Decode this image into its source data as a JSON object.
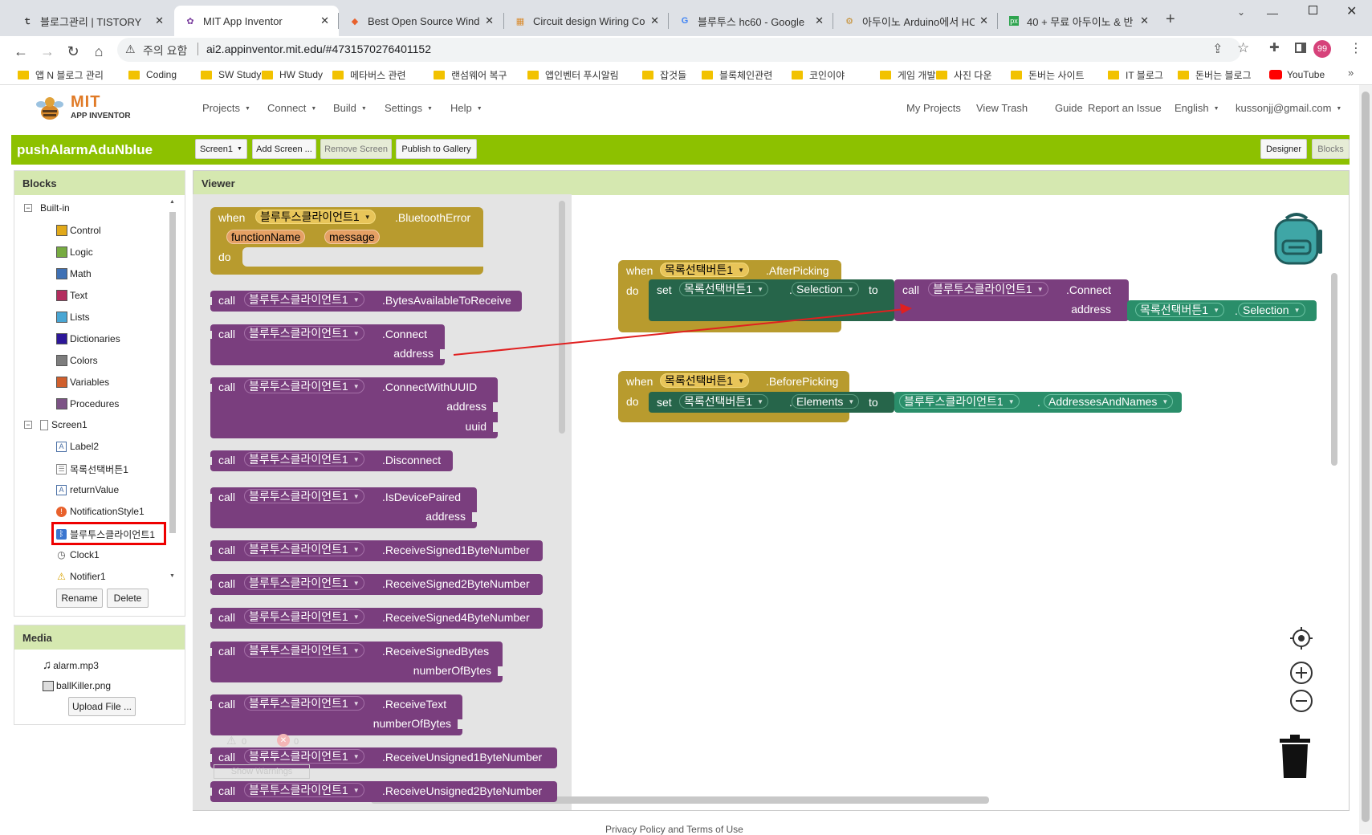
{
  "browser": {
    "tabs": [
      {
        "title": "블로그관리 | TISTORY",
        "icon": "tistory-icon"
      },
      {
        "title": "MIT App Inventor",
        "icon": "app-inventor-icon"
      },
      {
        "title": "Best Open Source Windo",
        "icon": "diamond-icon"
      },
      {
        "title": "Circuit design Wiring Co",
        "icon": "grid-icon"
      },
      {
        "title": "블루투스 hc60 - Google",
        "icon": "google-icon"
      },
      {
        "title": "아두이노 Arduino에서 HC",
        "icon": "site-icon"
      },
      {
        "title": "40 + 무료 아두이노 & 반",
        "icon": "px-icon"
      }
    ],
    "security": "주의 요함",
    "url": "ai2.appinventor.mit.edu/#4731570276401152",
    "profile": "99",
    "bookmarks": [
      "앱 N 블로그 관리",
      "Coding",
      "SW Study",
      "HW Study",
      "메타버스 관련",
      "랜섬웨어 복구",
      "앱인벤터 푸시알림",
      "잡것들",
      "블록체인관련",
      "코인이야",
      "게임 개발",
      "사진 다운",
      "돈버는 사이트",
      "IT 블로그",
      "돈버는 블로그",
      "YouTube"
    ]
  },
  "app": {
    "logo_top": "MIT",
    "logo_bottom": "APP INVENTOR",
    "menus": [
      "Projects",
      "Connect",
      "Build",
      "Settings",
      "Help"
    ],
    "right_links": [
      "My Projects",
      "View Trash",
      "Guide",
      "Report an Issue",
      "English",
      "kussonjj@gmail.com"
    ],
    "project_name": "pushAlarmAduNblue",
    "screen_select": "Screen1",
    "add_screen": "Add Screen ...",
    "remove_screen": "Remove Screen",
    "publish": "Publish to Gallery",
    "designer": "Designer",
    "blocks": "Blocks"
  },
  "blocks_panel": {
    "title": "Blocks",
    "builtin_label": "Built-in",
    "builtin": [
      {
        "label": "Control",
        "color": "#e1a91a"
      },
      {
        "label": "Logic",
        "color": "#77ab41"
      },
      {
        "label": "Math",
        "color": "#3f71b5"
      },
      {
        "label": "Text",
        "color": "#b32d5e"
      },
      {
        "label": "Lists",
        "color": "#49a6d4"
      },
      {
        "label": "Dictionaries",
        "color": "#2d1799"
      },
      {
        "label": "Colors",
        "color": "#7d7d7d"
      },
      {
        "label": "Variables",
        "color": "#d05f2d"
      },
      {
        "label": "Procedures",
        "color": "#7c5385"
      }
    ],
    "screen_label": "Screen1",
    "components": [
      {
        "label": "Label2",
        "icon": "label-icon"
      },
      {
        "label": "목록선택버튼1",
        "icon": "listpicker-icon"
      },
      {
        "label": "returnValue",
        "icon": "label-icon"
      },
      {
        "label": "NotificationStyle1",
        "icon": "notification-icon"
      },
      {
        "label": "블루투스클라이언트1",
        "icon": "bluetooth-icon"
      },
      {
        "label": "Clock1",
        "icon": "clock-icon"
      },
      {
        "label": "Notifier1",
        "icon": "warning-icon"
      }
    ],
    "rename": "Rename",
    "delete": "Delete"
  },
  "media": {
    "title": "Media",
    "files": [
      "alarm.mp3",
      "ballKiller.png"
    ],
    "upload": "Upload File ..."
  },
  "viewer": {
    "title": "Viewer",
    "warnings_count": "0",
    "errors_count": "0",
    "show_warnings": "Show Warnings",
    "footer": "Privacy Policy and Terms of Use"
  },
  "flyout": {
    "component": "블루투스클라이언트1",
    "event": {
      "when": "when",
      "name": ".BluetoothError",
      "params": [
        "functionName",
        "message"
      ],
      "do": "do"
    },
    "calls": [
      {
        "kw": "call",
        "method": ".BytesAvailableToReceive",
        "args": []
      },
      {
        "kw": "call",
        "method": ".Connect",
        "args": [
          "address"
        ]
      },
      {
        "kw": "call",
        "method": ".ConnectWithUUID",
        "args": [
          "address",
          "uuid"
        ]
      },
      {
        "kw": "call",
        "method": ".Disconnect",
        "args": []
      },
      {
        "kw": "call",
        "method": ".IsDevicePaired",
        "args": [
          "address"
        ]
      },
      {
        "kw": "call",
        "method": ".ReceiveSigned1ByteNumber",
        "args": []
      },
      {
        "kw": "call",
        "method": ".ReceiveSigned2ByteNumber",
        "args": []
      },
      {
        "kw": "call",
        "method": ".ReceiveSigned4ByteNumber",
        "args": []
      },
      {
        "kw": "call",
        "method": ".ReceiveSignedBytes",
        "args": [
          "numberOfBytes"
        ]
      },
      {
        "kw": "call",
        "method": ".ReceiveText",
        "args": [
          "numberOfBytes"
        ]
      },
      {
        "kw": "call",
        "method": ".ReceiveUnsigned1ByteNumber",
        "args": []
      },
      {
        "kw": "call",
        "method": ".ReceiveUnsigned2ByteNumber",
        "args": []
      }
    ]
  },
  "workspace": {
    "after_picking": {
      "when": "when",
      "component": "목록선택버튼1",
      "event": ".AfterPicking",
      "do": "do",
      "set": "set",
      "set_comp": "목록선택버튼1",
      "dot": ".",
      "set_prop": "Selection",
      "to": "to",
      "call": "call",
      "call_comp": "블루투스클라이언트1",
      "call_method": ".Connect",
      "arg": "address",
      "get_comp": "목록선택버튼1",
      "get_prop": "Selection"
    },
    "before_picking": {
      "when": "when",
      "component": "목록선택버튼1",
      "event": ".BeforePicking",
      "do": "do",
      "set": "set",
      "set_comp": "목록선택버튼1",
      "dot": ".",
      "set_prop": "Elements",
      "to": "to",
      "get_comp": "블루투스클라이언트1",
      "get_prop": "AddressesAndNames"
    }
  }
}
